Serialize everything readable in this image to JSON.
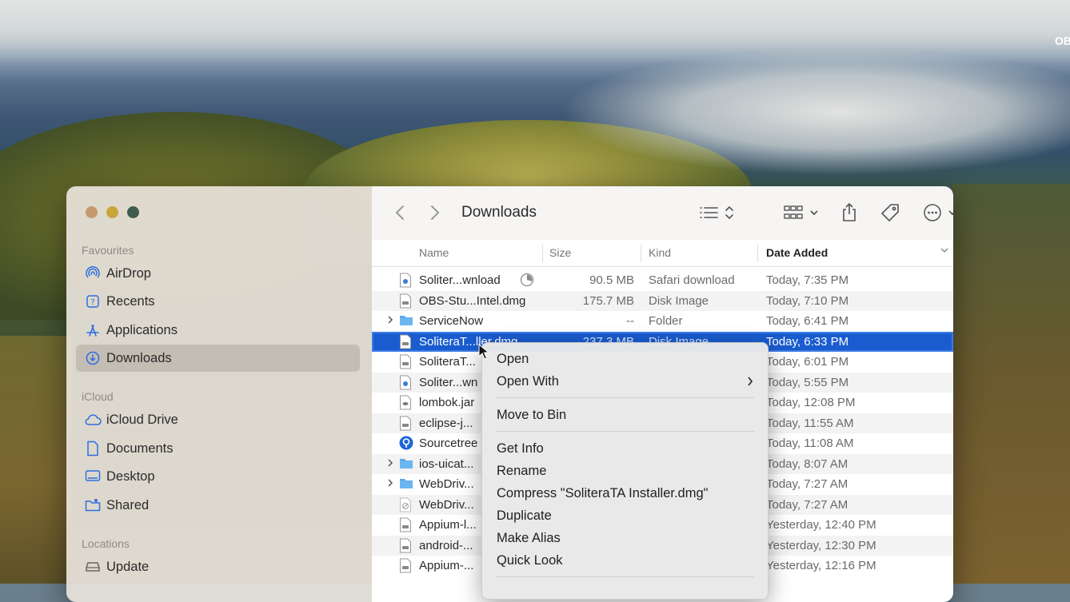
{
  "desktop": {
    "corner_label": "OBS"
  },
  "sidebar": {
    "sections": [
      {
        "label": "Favourites",
        "items": [
          {
            "label": "AirDrop",
            "icon": "airdrop-icon"
          },
          {
            "label": "Recents",
            "icon": "clock-icon"
          },
          {
            "label": "Applications",
            "icon": "applications-icon"
          },
          {
            "label": "Downloads",
            "icon": "downloads-icon",
            "selected": true
          }
        ]
      },
      {
        "label": "iCloud",
        "items": [
          {
            "label": "iCloud Drive",
            "icon": "cloud-icon"
          },
          {
            "label": "Documents",
            "icon": "document-icon"
          },
          {
            "label": "Desktop",
            "icon": "desktop-icon"
          },
          {
            "label": "Shared",
            "icon": "shared-folder-icon"
          }
        ]
      },
      {
        "label": "Locations",
        "items": [
          {
            "label": "Update",
            "icon": "drive-icon"
          }
        ]
      }
    ]
  },
  "toolbar": {
    "title": "Downloads"
  },
  "columns": {
    "name": "Name",
    "size": "Size",
    "kind": "Kind",
    "date": "Date Added"
  },
  "files": [
    {
      "name": "Soliter...wnload",
      "size": "90.5 MB",
      "kind": "Safari download",
      "date": "Today, 7:35 PM",
      "icon": "safari-download-icon",
      "progress": true
    },
    {
      "name": "OBS-Stu...Intel.dmg",
      "size": "175.7 MB",
      "kind": "Disk Image",
      "date": "Today, 7:10 PM",
      "icon": "disk-image-icon"
    },
    {
      "name": "ServiceNow",
      "size": "--",
      "kind": "Folder",
      "date": "Today, 6:41 PM",
      "icon": "folder-icon",
      "folder": true
    },
    {
      "name": "SoliteraT...ller.dmg",
      "size": "237.3 MB",
      "kind": "Disk Image",
      "date": "Today, 6:33 PM",
      "icon": "disk-image-icon",
      "selected": true
    },
    {
      "name": "SoliteraT...",
      "size": "",
      "kind": "",
      "date": "Today, 6:01 PM",
      "icon": "disk-image-icon"
    },
    {
      "name": "Soliter...wn",
      "size": "",
      "kind": "",
      "date": "Today, 5:55 PM",
      "icon": "safari-download-icon"
    },
    {
      "name": "lombok.jar",
      "size": "",
      "kind": "",
      "date": "Today, 12:08 PM",
      "icon": "jar-icon"
    },
    {
      "name": "eclipse-j...",
      "size": "",
      "kind": "",
      "date": "Today, 11:55 AM",
      "icon": "disk-image-icon"
    },
    {
      "name": "Sourcetree",
      "size": "",
      "kind": "",
      "date": "Today, 11:08 AM",
      "icon": "sourcetree-icon"
    },
    {
      "name": "ios-uicat...",
      "size": "",
      "kind": "",
      "date": "Today, 8:07 AM",
      "icon": "folder-icon",
      "folder": true
    },
    {
      "name": "WebDriv...",
      "size": "",
      "kind": "",
      "date": "Today, 7:27 AM",
      "icon": "folder-icon",
      "folder": true
    },
    {
      "name": "WebDriv...",
      "size": "",
      "kind": "",
      "date": "Today, 7:27 AM",
      "icon": "blocked-file-icon"
    },
    {
      "name": "Appium-l...",
      "size": "",
      "kind": "",
      "date": "Yesterday, 12:40 PM",
      "icon": "disk-image-icon"
    },
    {
      "name": "android-...",
      "size": "",
      "kind": "",
      "date": "Yesterday, 12:30 PM",
      "icon": "disk-image-icon"
    },
    {
      "name": "Appium-...",
      "size": "",
      "kind": "",
      "date": "Yesterday, 12:16 PM",
      "icon": "disk-image-icon"
    }
  ],
  "context_menu": {
    "open": "Open",
    "open_with": "Open With",
    "move_to_bin": "Move to Bin",
    "get_info": "Get Info",
    "rename": "Rename",
    "compress": "Compress \"SoliteraTA Installer.dmg\"",
    "duplicate": "Duplicate",
    "make_alias": "Make Alias",
    "quick_look": "Quick Look"
  },
  "colors": {
    "selection": "#1a5ccf",
    "folder": "#5aa7e8",
    "sidebar_accent": "#2f6ee0"
  }
}
